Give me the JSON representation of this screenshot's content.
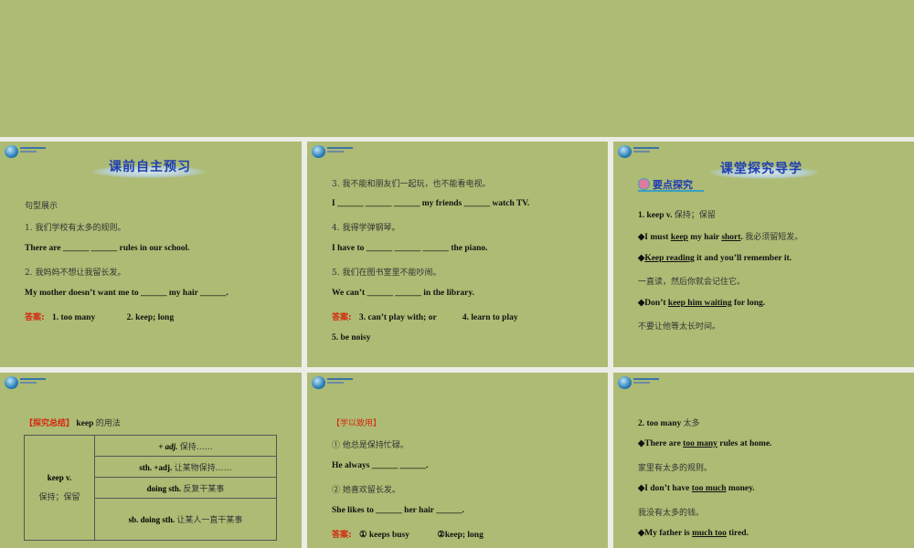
{
  "slide1": {
    "title": "课前自主预习",
    "section": "句型展示",
    "q1_cn": "1.  我们学校有太多的规则。",
    "q1_en": "There are ______ ______ rules in our school.",
    "q2_cn": "2.  我妈妈不想让我留长发。",
    "q2_en": "My mother doesn’t want me to ______ my hair ______.",
    "answer_label": "答案:",
    "answer1": "1. too many",
    "answer2": "2. keep; long"
  },
  "slide2": {
    "q3_cn": "3.  我不能和朋友们一起玩，也不能看电视。",
    "q3_en": "I ______ ______ ______ my friends ______ watch TV.",
    "q4_cn": "4.  我得学弹钢琴。",
    "q4_en": "I have to ______ ______ ______ the piano.",
    "q5_cn": "5.  我们在图书室里不能吵闹。",
    "q5_en": "We can’t ______ ______ in the library.",
    "answer_label": "答案:",
    "answer3": "3. can’t play with; or",
    "answer4": "4. learn to play",
    "answer5": "5. be noisy"
  },
  "slide3": {
    "title": "课堂探究导学",
    "badge": "要点探究",
    "heading_en": "1. keep v.",
    "heading_cn": "保持；保留",
    "ex1": [
      "◆I must ",
      "keep",
      " my hair ",
      "short",
      "."
    ],
    "ex1_cn": "我必须留短发。",
    "ex2": [
      "◆",
      "Keep reading",
      " it and you’ll remember it."
    ],
    "ex2_cn": "一直读，然后你就会记住它。",
    "ex3": [
      "◆Don’t ",
      "keep him waiting",
      " for long."
    ],
    "ex3_cn": "不要让他等太长时间。"
  },
  "slide4": {
    "label": "【探究总结】",
    "heading_en": "keep",
    "heading_cn": "的用法",
    "left_en": "keep v.",
    "left_cn": "保持；保留",
    "rows": [
      {
        "en": "+ adj.",
        "cn": "保持……"
      },
      {
        "en": "sth. +adj.",
        "cn": "让某物保持……"
      },
      {
        "en": "doing sth.",
        "cn": "反复干某事"
      },
      {
        "en": "sb. doing sth.",
        "cn": "让某人一直干某事"
      }
    ]
  },
  "slide5": {
    "label": "【学以致用】",
    "q1_cn": "① 他总是保持忙碌。",
    "q1_en": "He always ______ ______.",
    "q2_cn": "② 她喜欢留长发。",
    "q2_en": "She likes to ______ her hair ______.",
    "answer_label": "答案:",
    "answer1": "① keeps busy",
    "answer2": "②keep; long"
  },
  "slide6": {
    "heading_en": "2. too many",
    "heading_cn": "太多",
    "ex1": [
      "◆There are ",
      "too many",
      " rules at home."
    ],
    "ex1_cn": "家里有太多的规则。",
    "ex2": [
      "◆I don’t have ",
      "too much",
      " money."
    ],
    "ex2_cn": "我没有太多的钱。",
    "ex3": [
      "◆My father is ",
      "much too",
      " tired."
    ]
  }
}
